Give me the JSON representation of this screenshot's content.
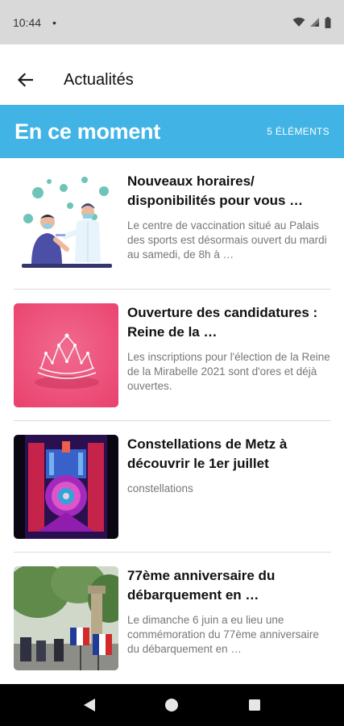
{
  "status_bar": {
    "time": "10:44",
    "dot": "•"
  },
  "app_bar": {
    "title": "Actualités"
  },
  "banner": {
    "heading": "En ce moment",
    "count": "5 ÉLÉMENTS"
  },
  "items": [
    {
      "title": "Nouveaux horaires/ disponibilités pour vous …",
      "description": "Le centre de vaccination situé au Palais des sports est désormais ouvert du mardi au samedi, de 8h à …",
      "image": "vaccination-illustration"
    },
    {
      "title": "Ouverture des candidatures : Reine de la …",
      "description": "Les inscriptions pour l'élection de la Reine de la Mirabelle 2021 sont d'ores et déjà ouvertes.",
      "image": "tiara-photo"
    },
    {
      "title": "Constellations de Metz à découvrir le 1er juillet",
      "description": "constellations",
      "image": "light-projection-photo"
    },
    {
      "title": "77ème anniversaire du débarquement en …",
      "description": "Le dimanche 6 juin a eu lieu une commémoration du 77ème anniversaire du débarquement en …",
      "image": "ceremony-flags-photo"
    }
  ],
  "colors": {
    "banner": "#41b4e5",
    "status_bar": "#d9d9d9",
    "nav_bar": "#000000"
  }
}
